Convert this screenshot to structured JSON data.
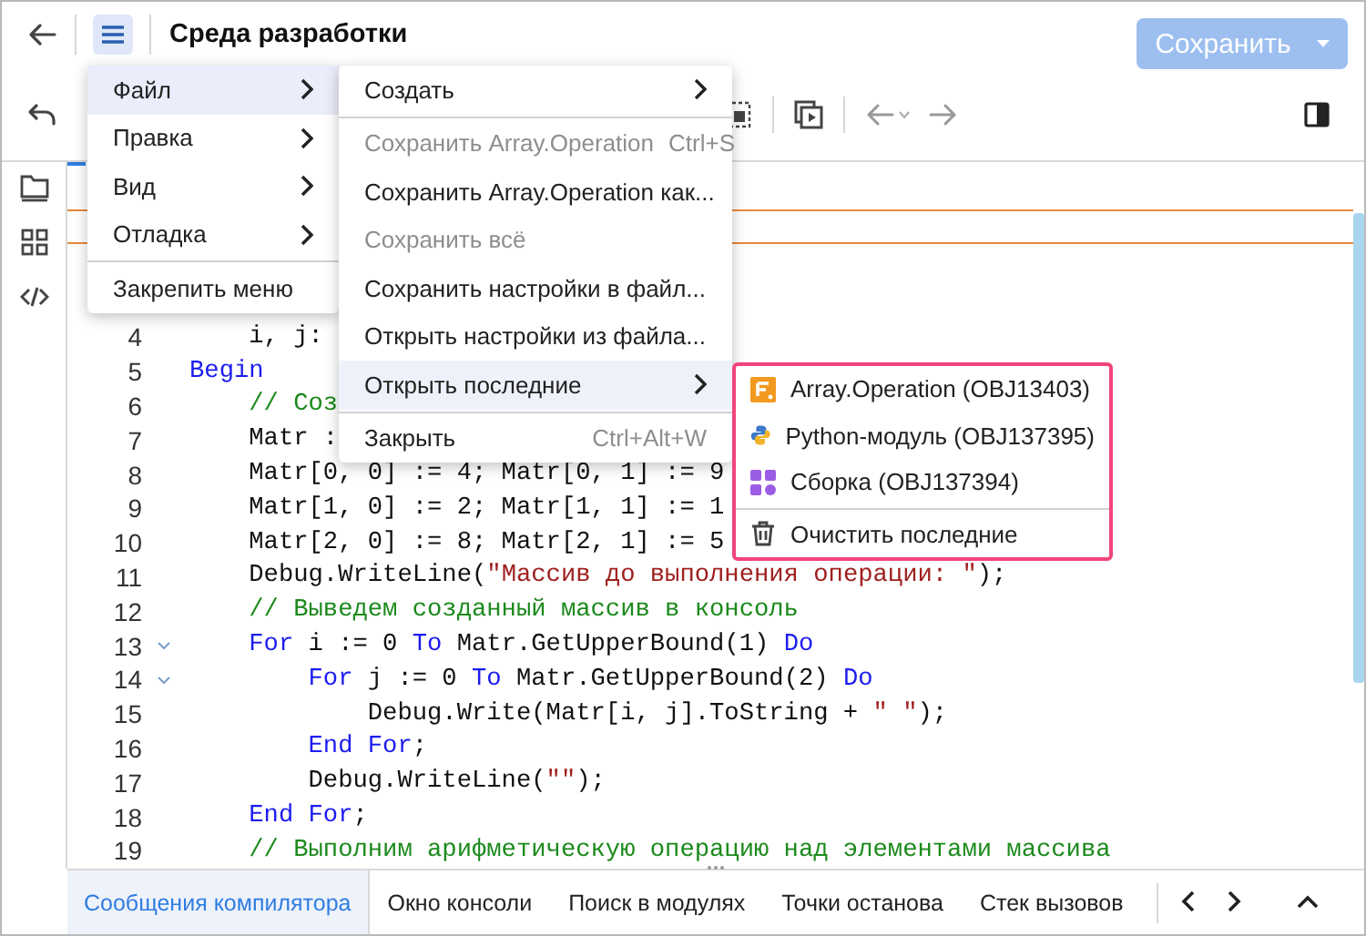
{
  "header": {
    "title": "Среда разработки",
    "save_button": {
      "label": "Сохранить",
      "disabled": true
    }
  },
  "main_menu": [
    {
      "kind": "submenu",
      "label": "Файл",
      "selected": true
    },
    {
      "kind": "submenu",
      "label": "Правка",
      "selected": false
    },
    {
      "kind": "submenu",
      "label": "Вид",
      "selected": false
    },
    {
      "kind": "submenu",
      "label": "Отладка",
      "selected": false
    },
    {
      "kind": "separator"
    },
    {
      "kind": "action",
      "label": "Закрепить меню",
      "selected": false
    }
  ],
  "file_menu": [
    {
      "kind": "submenu",
      "label": "Создать",
      "selected": false,
      "disabled": false
    },
    {
      "kind": "separator"
    },
    {
      "kind": "action",
      "label": "Сохранить Array.Operation",
      "shortcut": "Ctrl+S",
      "selected": false,
      "disabled": true
    },
    {
      "kind": "action",
      "label": "Сохранить Array.Operation как...",
      "selected": false,
      "disabled": false
    },
    {
      "kind": "action",
      "label": "Сохранить всё",
      "selected": false,
      "disabled": true
    },
    {
      "kind": "action",
      "label": "Сохранить настройки в файл...",
      "selected": false,
      "disabled": false
    },
    {
      "kind": "action",
      "label": "Открыть настройки из файла...",
      "selected": false,
      "disabled": false
    },
    {
      "kind": "submenu",
      "label": "Открыть последние",
      "selected": true,
      "disabled": false
    },
    {
      "kind": "separator"
    },
    {
      "kind": "action",
      "label": "Закрыть",
      "shortcut": "Ctrl+Alt+W",
      "selected": false,
      "disabled": false
    }
  ],
  "recent_menu": {
    "highlighted": true,
    "items": [
      {
        "kind": "form",
        "label": "Array.Operation (OBJ13403)"
      },
      {
        "kind": "python",
        "label": "Python-модуль (OBJ137395)"
      },
      {
        "kind": "assembly",
        "label": "Сборка (OBJ137394)"
      },
      {
        "kind": "separator"
      },
      {
        "kind": "clear",
        "label": "Очистить последние"
      }
    ]
  },
  "editor": {
    "lines": [
      {
        "number": "4",
        "foldable": false,
        "tokens": [
          {
            "kind": "plain",
            "text": "    i, j:"
          }
        ]
      },
      {
        "number": "5",
        "foldable": false,
        "tokens": [
          {
            "kind": "keyword",
            "text": "Begin"
          }
        ]
      },
      {
        "number": "6",
        "foldable": false,
        "tokens": [
          {
            "kind": "comment",
            "text": "    // Соз"
          }
        ]
      },
      {
        "number": "7",
        "foldable": false,
        "tokens": [
          {
            "kind": "plain",
            "text": "    Matr :"
          }
        ]
      },
      {
        "number": "8",
        "foldable": false,
        "tokens": [
          {
            "kind": "plain",
            "text": "    Matr[0, 0] := 4; Matr[0, 1] := 9"
          }
        ]
      },
      {
        "number": "9",
        "foldable": false,
        "tokens": [
          {
            "kind": "plain",
            "text": "    Matr[1, 0] := 2; Matr[1, 1] := 1"
          }
        ]
      },
      {
        "number": "10",
        "foldable": false,
        "tokens": [
          {
            "kind": "plain",
            "text": "    Matr[2, 0] := 8; Matr[2, 1] := 5"
          }
        ]
      },
      {
        "number": "11",
        "foldable": false,
        "tokens": [
          {
            "kind": "plain",
            "text": "    Debug.WriteLine("
          },
          {
            "kind": "string",
            "text": "\"Массив до выполнения операции: \""
          },
          {
            "kind": "plain",
            "text": ");"
          }
        ]
      },
      {
        "number": "12",
        "foldable": false,
        "tokens": [
          {
            "kind": "comment",
            "text": "    // Выведем созданный массив в консоль"
          }
        ]
      },
      {
        "number": "13",
        "foldable": true,
        "tokens": [
          {
            "kind": "keyword",
            "text": "    For"
          },
          {
            "kind": "plain",
            "text": " i := 0 "
          },
          {
            "kind": "keyword",
            "text": "To"
          },
          {
            "kind": "plain",
            "text": " Matr.GetUpperBound(1) "
          },
          {
            "kind": "keyword",
            "text": "Do"
          }
        ]
      },
      {
        "number": "14",
        "foldable": true,
        "tokens": [
          {
            "kind": "keyword",
            "text": "        For"
          },
          {
            "kind": "plain",
            "text": " j := 0 "
          },
          {
            "kind": "keyword",
            "text": "To"
          },
          {
            "kind": "plain",
            "text": " Matr.GetUpperBound(2) "
          },
          {
            "kind": "keyword",
            "text": "Do"
          }
        ]
      },
      {
        "number": "15",
        "foldable": false,
        "tokens": [
          {
            "kind": "plain",
            "text": "            Debug.Write(Matr[i, j].ToString + "
          },
          {
            "kind": "string",
            "text": "\" \""
          },
          {
            "kind": "plain",
            "text": ");"
          }
        ]
      },
      {
        "number": "16",
        "foldable": false,
        "tokens": [
          {
            "kind": "keyword",
            "text": "        End For"
          },
          {
            "kind": "plain",
            "text": ";"
          }
        ]
      },
      {
        "number": "17",
        "foldable": false,
        "tokens": [
          {
            "kind": "plain",
            "text": "        Debug.WriteLine("
          },
          {
            "kind": "string",
            "text": "\"\""
          },
          {
            "kind": "plain",
            "text": ");"
          }
        ]
      },
      {
        "number": "18",
        "foldable": false,
        "tokens": [
          {
            "kind": "keyword",
            "text": "    End For"
          },
          {
            "kind": "plain",
            "text": ";"
          }
        ]
      },
      {
        "number": "19",
        "foldable": false,
        "tokens": [
          {
            "kind": "comment",
            "text": "    // Выполним арифметическую операцию над элементами массива"
          }
        ]
      }
    ]
  },
  "bottom_tabs": [
    {
      "label": "Сообщения компилятора",
      "selected": true
    },
    {
      "label": "Окно консоли",
      "selected": false
    },
    {
      "label": "Поиск в модулях",
      "selected": false
    },
    {
      "label": "Точки останова",
      "selected": false
    },
    {
      "label": "Стек вызовов",
      "selected": false
    }
  ]
}
